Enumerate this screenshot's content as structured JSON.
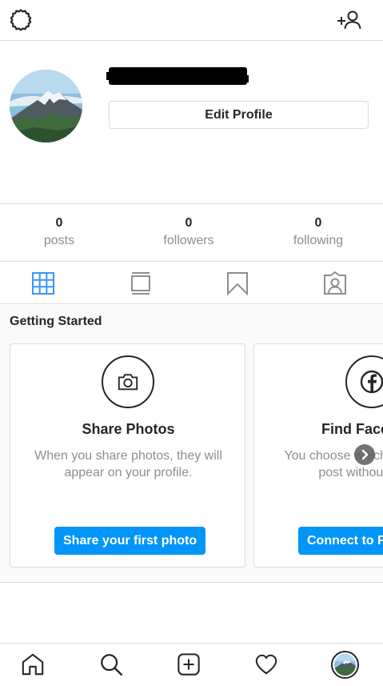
{
  "header": {
    "settings_icon": "settings-gear-icon",
    "add_user_icon": "add-user-icon"
  },
  "profile": {
    "edit_label": "Edit Profile"
  },
  "stats": [
    {
      "value": "0",
      "label": "posts"
    },
    {
      "value": "0",
      "label": "followers"
    },
    {
      "value": "0",
      "label": "following"
    }
  ],
  "tabs": [
    {
      "icon": "grid-icon",
      "active": true
    },
    {
      "icon": "feed-icon",
      "active": false
    },
    {
      "icon": "bookmark-icon",
      "active": false
    },
    {
      "icon": "tagged-icon",
      "active": false
    }
  ],
  "getting_started": {
    "title": "Getting Started",
    "cards": [
      {
        "icon": "camera-icon",
        "title": "Share Photos",
        "description": "When you share photos, they will appear on your profile.",
        "button": "Share your first photo"
      },
      {
        "icon": "facebook-icon",
        "title": "Find Facebook",
        "description": "You choose which f We'll never post without your p",
        "button": "Connect to F"
      }
    ]
  },
  "bottom_nav": [
    {
      "icon": "home-icon"
    },
    {
      "icon": "search-icon"
    },
    {
      "icon": "new-post-icon"
    },
    {
      "icon": "heart-icon"
    },
    {
      "icon": "profile-avatar"
    }
  ],
  "colors": {
    "accent": "#0095f6",
    "active_tab": "#3897f0",
    "text": "#262626",
    "muted": "#8e8e8e",
    "border": "#dbdbdb"
  }
}
